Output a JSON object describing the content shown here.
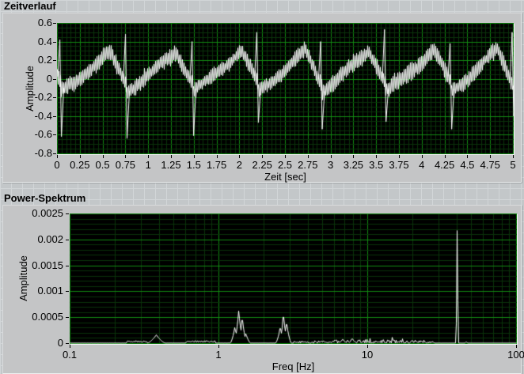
{
  "chart_data": [
    {
      "type": "line",
      "title": "Zeitverlauf",
      "xlabel": "Zeit [sec]",
      "ylabel": "Amplitude",
      "xlim": [
        0,
        5
      ],
      "ylim": [
        -0.8,
        0.6
      ],
      "x_tick_labels": [
        "0",
        "0.25",
        "0.5",
        "0.75",
        "1",
        "1.25",
        "1.5",
        "1.75",
        "2",
        "2.25",
        "2.5",
        "2.75",
        "3",
        "3.25",
        "3.5",
        "3.75",
        "4",
        "4.25",
        "4.5",
        "4.75",
        "5"
      ],
      "y_tick_labels": [
        "0.6",
        "0.4",
        "0.2",
        "0",
        "-0.2",
        "-0.4",
        "-0.6",
        "-0.8"
      ],
      "x_minor_step": 0.05,
      "x_major_step": 0.25,
      "y_minor_step": 0.05,
      "y_major_step": 0.2,
      "grid_on": true,
      "plot_bg": "#000000",
      "grid_minor_color": "#0a330a",
      "grid_major_color": "#128a12",
      "line_color": "#ffffff",
      "description": "Noisy ECG-like waveform: ~1.4 Hz heartbeats with sharp R-spikes, slow ramp between beats, dense high-frequency (40 Hz) noise band of roughly +/-0.1 amplitude",
      "beats": [
        {
          "t": 0.04,
          "up": 0.42,
          "down": -0.62
        },
        {
          "t": 0.76,
          "up": 0.48,
          "down": -0.64
        },
        {
          "t": 1.49,
          "up": 0.4,
          "down": -0.61
        },
        {
          "t": 2.2,
          "up": 0.5,
          "down": -0.47
        },
        {
          "t": 2.9,
          "up": 0.4,
          "down": -0.54
        },
        {
          "t": 3.6,
          "up": 0.53,
          "down": -0.46
        },
        {
          "t": 4.32,
          "up": 0.38,
          "down": -0.54
        },
        {
          "t": 5.0,
          "up": 0.5,
          "down": -0.4
        }
      ],
      "interbeat_ramp": {
        "start": -0.13,
        "peak": 0.27,
        "peak_frac": 0.74,
        "end": -0.06
      },
      "noise": {
        "band": 0.1,
        "seed": 11
      }
    },
    {
      "type": "line",
      "title": "Power-Spektrum",
      "xlabel": "Freq [Hz]",
      "ylabel": "Amplitude",
      "x_scale": "log",
      "xlim": [
        0.1,
        100
      ],
      "ylim": [
        0,
        0.0025
      ],
      "x_tick_labels": [
        "0.1",
        "1",
        "10",
        "100"
      ],
      "y_tick_labels": [
        "0.0025",
        "0.002",
        "0.0015",
        "0.001",
        "0.0005",
        "0"
      ],
      "y_minor_step": 0.0001,
      "y_major_step": 0.0005,
      "grid_on": true,
      "plot_bg": "#000000",
      "grid_minor_color": "#0a330a",
      "grid_major_color": "#128a12",
      "line_color": "#ffffff",
      "description": "Power spectrum of the time signal: fundamental peak cluster near 1.4 Hz (~0.0006), harmonic cluster near 2.7 Hz (~0.0005), small bump at 0.38 Hz, broadband noise floor between ~3 and 28 Hz, dominant narrow spike at 40 Hz reaching ~0.0022",
      "peaks": [
        {
          "f": 0.38,
          "amp": 0.00016,
          "w": 4
        },
        {
          "f": 1.28,
          "amp": 0.0003,
          "w": 2
        },
        {
          "f": 1.36,
          "amp": 0.00062,
          "w": 2
        },
        {
          "f": 1.44,
          "amp": 0.00044,
          "w": 2
        },
        {
          "f": 1.52,
          "amp": 0.00018,
          "w": 2
        },
        {
          "f": 2.58,
          "amp": 0.00028,
          "w": 2
        },
        {
          "f": 2.72,
          "amp": 0.0005,
          "w": 2
        },
        {
          "f": 2.86,
          "amp": 0.00036,
          "w": 2
        },
        {
          "f": 6.8,
          "amp": 7e-05,
          "w": 2
        },
        {
          "f": 7.9,
          "amp": 8e-05,
          "w": 2
        },
        {
          "f": 40.0,
          "amp": 0.00217,
          "w": 0.6
        },
        {
          "f": 46.0,
          "amp": 2e-05,
          "w": 1
        }
      ],
      "plateaus": [
        {
          "f1": 0.24,
          "f2": 0.33,
          "amp": 4e-05
        },
        {
          "f1": 0.6,
          "f2": 0.95,
          "amp": 4e-05
        }
      ],
      "noise_band": {
        "f1": 3.2,
        "f2": 28,
        "amp": 7e-05,
        "seed": 5
      }
    }
  ]
}
